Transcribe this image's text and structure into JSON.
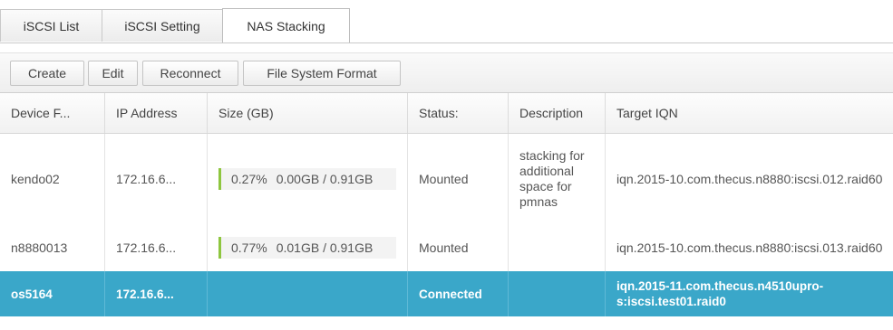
{
  "tabs": [
    {
      "label": "iSCSI List",
      "active": false
    },
    {
      "label": "iSCSI Setting",
      "active": false
    },
    {
      "label": "NAS Stacking",
      "active": true
    }
  ],
  "toolbar": {
    "create_label": "Create",
    "edit_label": "Edit",
    "reconnect_label": "Reconnect",
    "format_label": "File System Format"
  },
  "table": {
    "columns": [
      "Device F...",
      "IP Address",
      "Size (GB)",
      "Status:",
      "Description",
      "Target IQN"
    ],
    "rows": [
      {
        "device": "kendo02",
        "ip": "172.16.6...",
        "size_pct": "0.27%",
        "size_used": "0.00GB / 0.91GB",
        "usage_fraction": 0.0027,
        "status": "Mounted",
        "description": "stacking for additional space for pmnas",
        "iqn": "iqn.2015-10.com.thecus.n8880:iscsi.012.raid60",
        "selected": false
      },
      {
        "device": "n8880013",
        "ip": "172.16.6...",
        "size_pct": "0.77%",
        "size_used": "0.01GB / 0.91GB",
        "usage_fraction": 0.0077,
        "status": "Mounted",
        "description": "",
        "iqn": "iqn.2015-10.com.thecus.n8880:iscsi.013.raid60",
        "selected": false
      },
      {
        "device": "os5164",
        "ip": "172.16.6...",
        "size_pct": "",
        "size_used": "",
        "status": "Connected",
        "description": "",
        "iqn": "iqn.2015-11.com.thecus.n4510upro-s:iscsi.test01.raid0",
        "selected": true
      }
    ]
  },
  "colors": {
    "selected_row": "#3aa7c9",
    "usage_bar": "#8ec63f"
  }
}
